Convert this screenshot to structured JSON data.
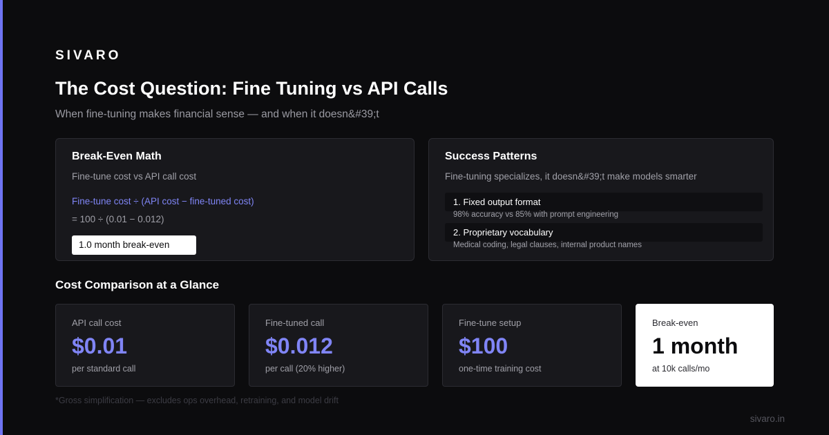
{
  "brand": "SIVARO",
  "title": "The Cost Question: Fine Tuning vs API Calls",
  "subtitle": "When fine-tuning makes financial sense — and when it doesn&#39;t",
  "colors": {
    "background": "#0c0c0e",
    "accent": "#6f74f2",
    "panel": "#18181c",
    "highlight_card": "#ffffff"
  },
  "break_even_panel": {
    "title": "Break-Even Math",
    "description": "Fine-tune cost vs API call cost",
    "formula": "Fine-tune cost ÷ (API cost − fine-tuned cost)",
    "calculation": "= 100 ÷ (0.01 − 0.012)",
    "result": "1.0 month break-even"
  },
  "success_panel": {
    "title": "Success Patterns",
    "description": "Fine-tuning specializes, it doesn&#39;t make models smarter",
    "patterns": [
      {
        "label": "1. Fixed output format",
        "detail": "98% accuracy vs 85% with prompt engineering"
      },
      {
        "label": "2. Proprietary vocabulary",
        "detail": "Medical coding, legal clauses, internal product names"
      }
    ]
  },
  "comparison": {
    "title": "Cost Comparison at a Glance",
    "cards": [
      {
        "label": "API call cost",
        "value": "$0.01",
        "note": "per standard call"
      },
      {
        "label": "Fine-tuned call",
        "value": "$0.012",
        "note": "per call (20% higher)"
      },
      {
        "label": "Fine-tune setup",
        "value": "$100",
        "note": "one-time training cost"
      },
      {
        "label": "Break-even",
        "value": "1 month",
        "note": "at 10k calls/mo"
      }
    ]
  },
  "footnote": "*Gross simplification — excludes ops overhead, retraining, and model drift",
  "site": "sivaro.in"
}
